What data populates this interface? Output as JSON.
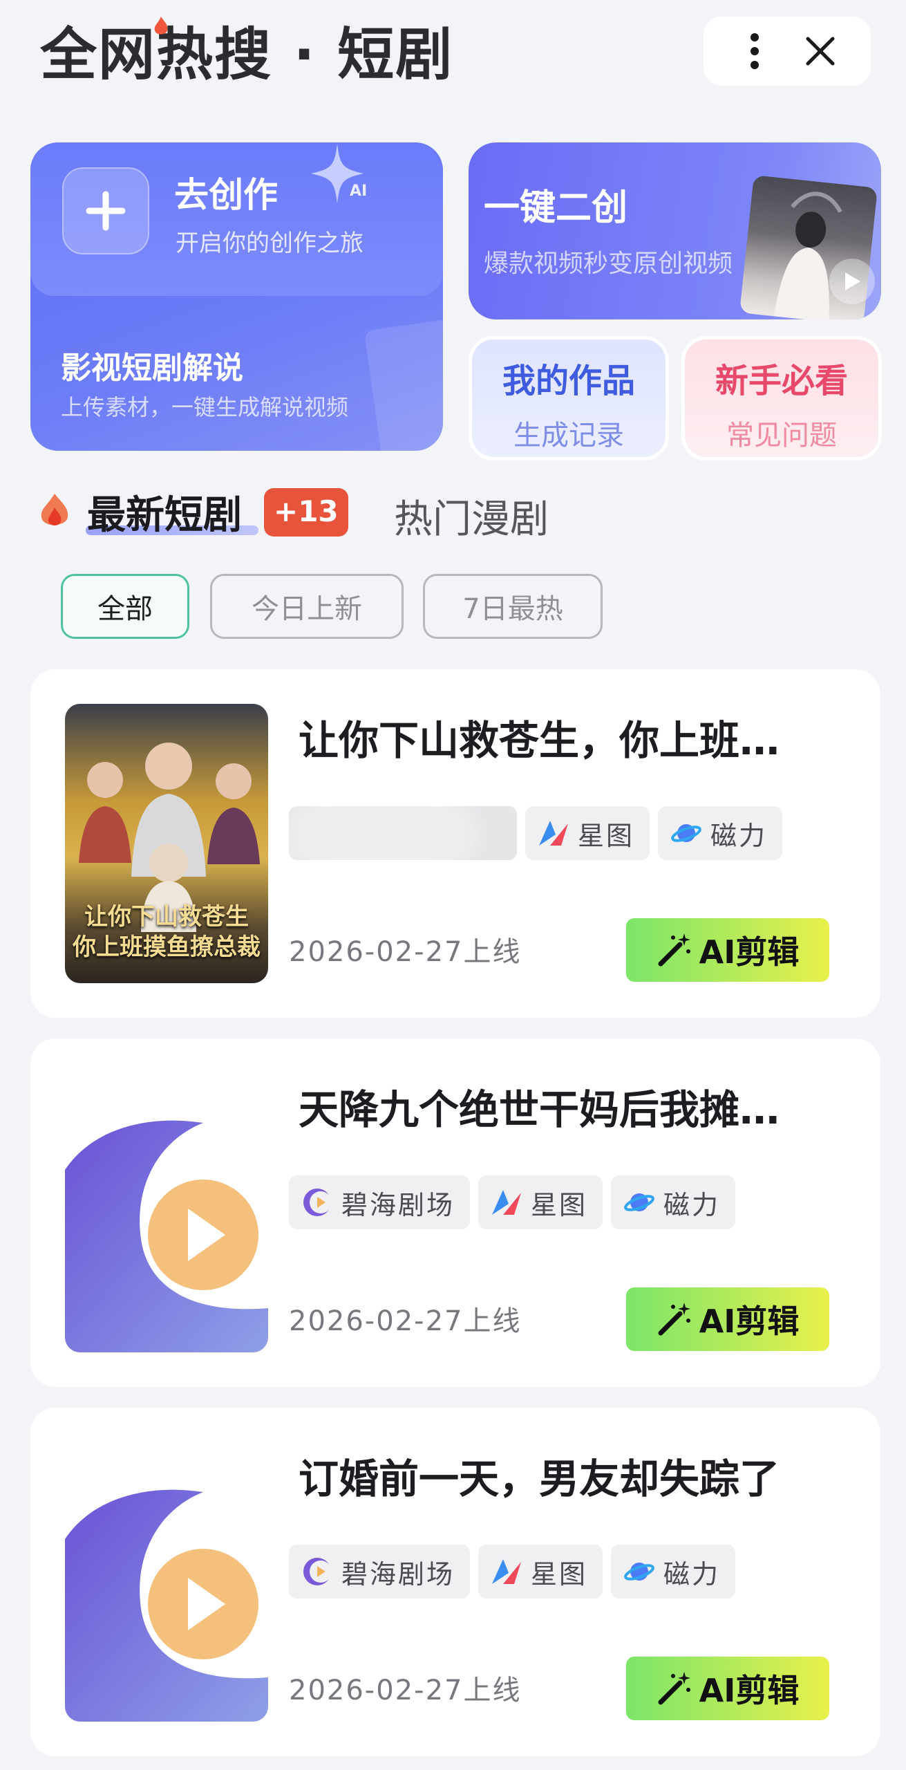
{
  "header": {
    "title": "全网热搜 · 短剧",
    "more_icon": "more-vertical-icon",
    "close_icon": "close-icon"
  },
  "features": {
    "create": {
      "title": "去创作",
      "subtitle": "开启你的创作之旅",
      "badge": "AI",
      "explain_title": "影视短剧解说",
      "explain_subtitle": "上传素材，一键生成解说视频"
    },
    "onekey": {
      "title": "一键二创",
      "subtitle": "爆款视频秒变原创视频"
    },
    "my_works": {
      "title": "我的作品",
      "subtitle": "生成记录"
    },
    "guide": {
      "title": "新手必看",
      "subtitle": "常见问题"
    }
  },
  "tabs": {
    "latest": "最新短剧",
    "latest_badge": "+13",
    "manga": "热门漫剧"
  },
  "filters": [
    "全部",
    "今日上新",
    "7日最热"
  ],
  "dramas": [
    {
      "title": "让你下山救苍生，你上班…",
      "poster_caption_1": "让你下山救苍生",
      "poster_caption_2": "你上班摸鱼撩总裁",
      "tags": [
        "星图",
        "磁力"
      ],
      "date": "2026-02-27上线",
      "button": "AI剪辑"
    },
    {
      "title": "天降九个绝世干妈后我摊…",
      "tags": [
        "碧海剧场",
        "星图",
        "磁力"
      ],
      "date": "2026-02-27上线",
      "button": "AI剪辑"
    },
    {
      "title": "订婚前一天，男友却失踪了",
      "tags": [
        "碧海剧场",
        "星图",
        "磁力"
      ],
      "date": "2026-02-27上线",
      "button": "AI剪辑"
    }
  ],
  "colors": {
    "accent_blue": "#5a6cf6",
    "badge_red": "#e8533c",
    "chip_active": "#4fc3a1",
    "ai_button_start": "#7be56a",
    "ai_button_end": "#e9f04c"
  }
}
